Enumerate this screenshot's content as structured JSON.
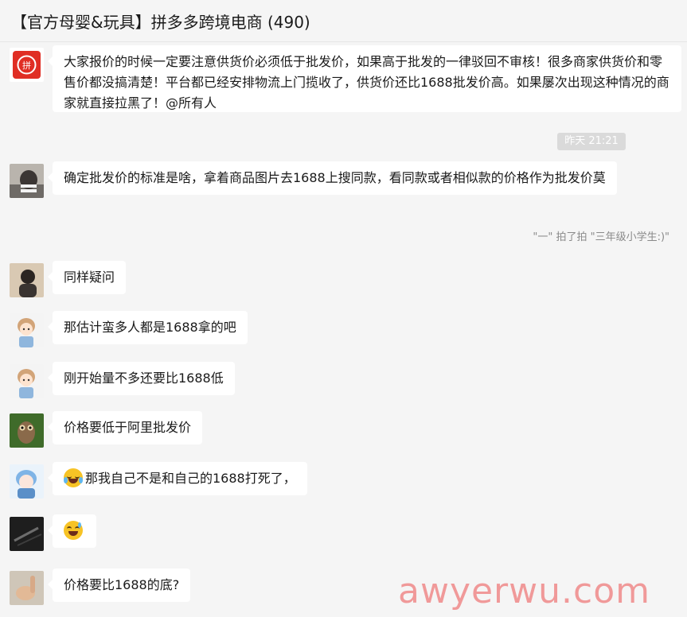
{
  "chat": {
    "title": "【官方母婴&玩具】拼多多跨境电商 (490)"
  },
  "messages": [
    {
      "text": "大家报价的时候一定要注意供货价必须低于批发价，如果高于批发的一律驳回不审核！很多商家供货价和零售价都没搞清楚！平台都已经安排物流上门揽收了，供货价还比1688批发价高。如果屡次出现这种情况的商家就直接拉黑了！@所有人"
    },
    {
      "text": "确定批发价的标准是啥，拿着商品图片去1688上搜同款，看同款或者相似款的价格作为批发价莫"
    },
    {
      "text": "同样疑问"
    },
    {
      "text": "那估计蛮多人都是1688拿的吧"
    },
    {
      "text": "刚开始量不多还要比1688低"
    },
    {
      "text": "价格要低于阿里批发价"
    },
    {
      "text": "那我自己不是和自己的1688打死了，",
      "emoji": "crying-laughing"
    },
    {
      "text": "",
      "emoji": "grinning-sweat"
    },
    {
      "text": "价格要比1688的底?"
    }
  ],
  "timestamp": "昨天 21:21",
  "system_message": "\"一\" 拍了拍 \"三年级小学生:)\"",
  "group_avatar_label": "拼",
  "watermark": "awyerwu.com",
  "colors": {
    "background": "#f5f5f5",
    "bubble": "#ffffff",
    "brand_red": "#e02e24"
  }
}
